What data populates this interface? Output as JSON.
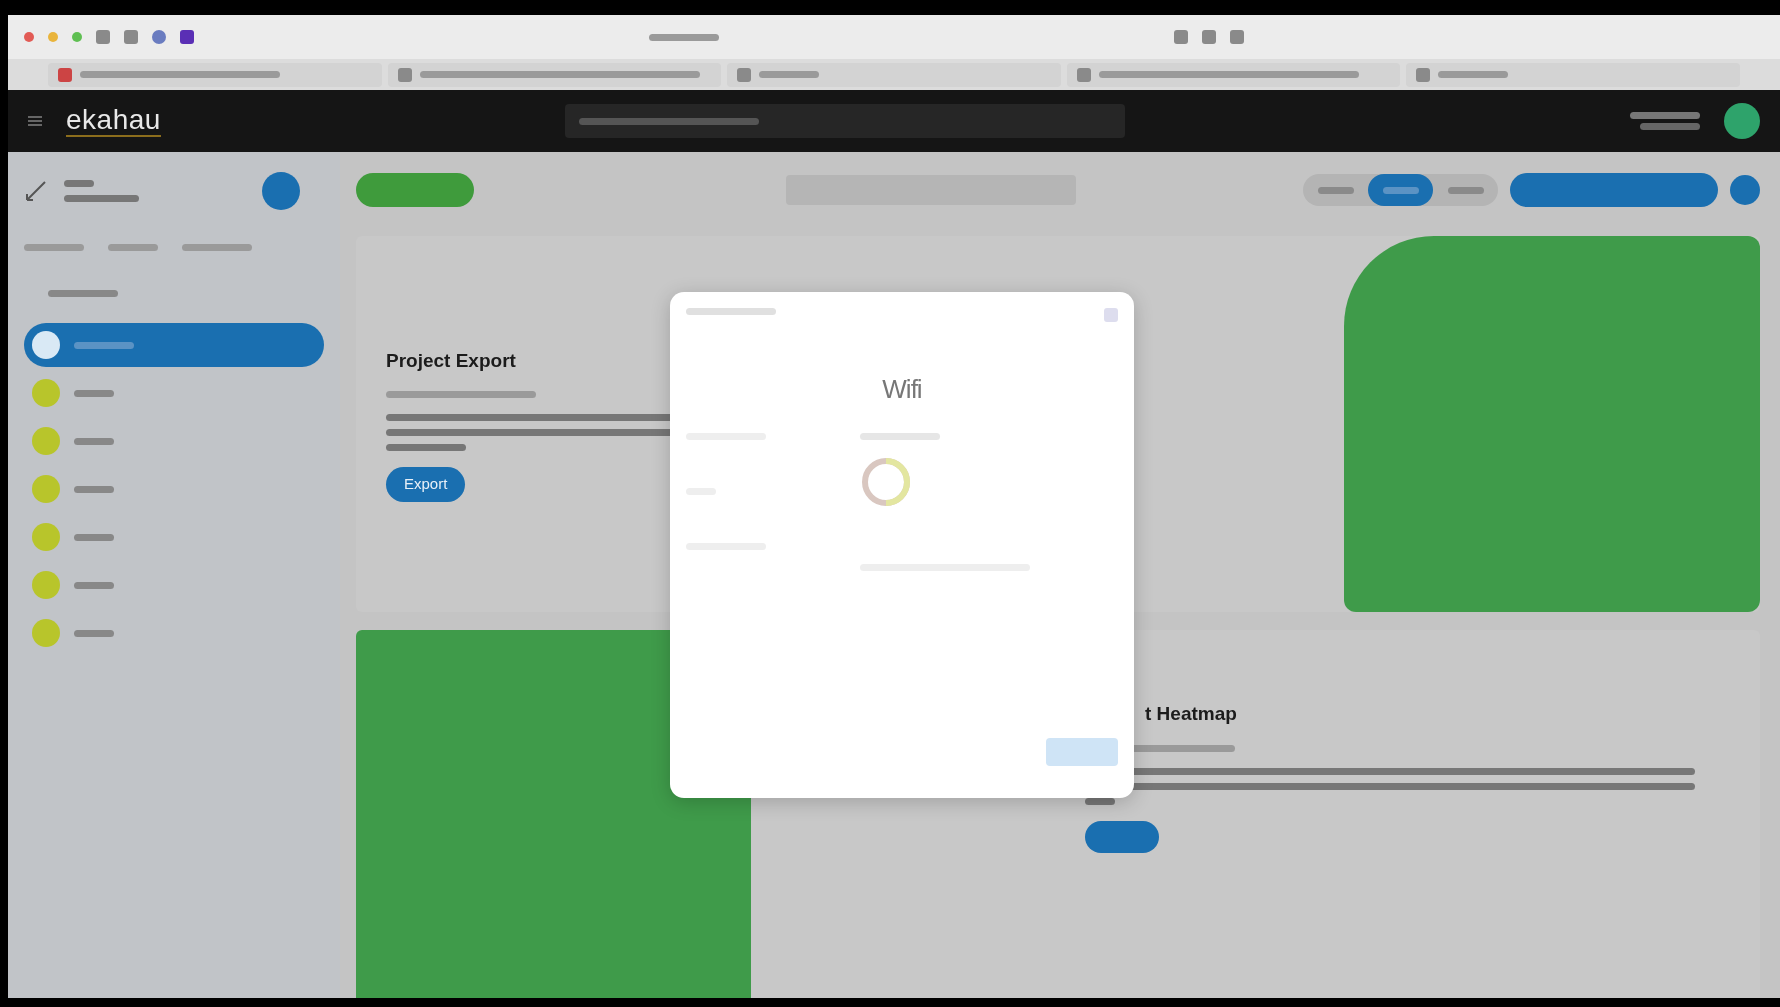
{
  "header": {
    "logo": "ekahau"
  },
  "sidebar": {
    "items": [
      {
        "selected": true
      },
      {
        "selected": false
      },
      {
        "selected": false
      },
      {
        "selected": false
      },
      {
        "selected": false
      },
      {
        "selected": false
      },
      {
        "selected": false
      }
    ]
  },
  "toolbar": {
    "segments": [
      {
        "selected": false
      },
      {
        "selected": true
      },
      {
        "selected": false
      }
    ]
  },
  "cards": [
    {
      "title": "Project Export",
      "button": "Export"
    },
    {
      "title": "t Heatmap"
    }
  ],
  "modal": {
    "logo": "Wifi",
    "loading": true
  }
}
